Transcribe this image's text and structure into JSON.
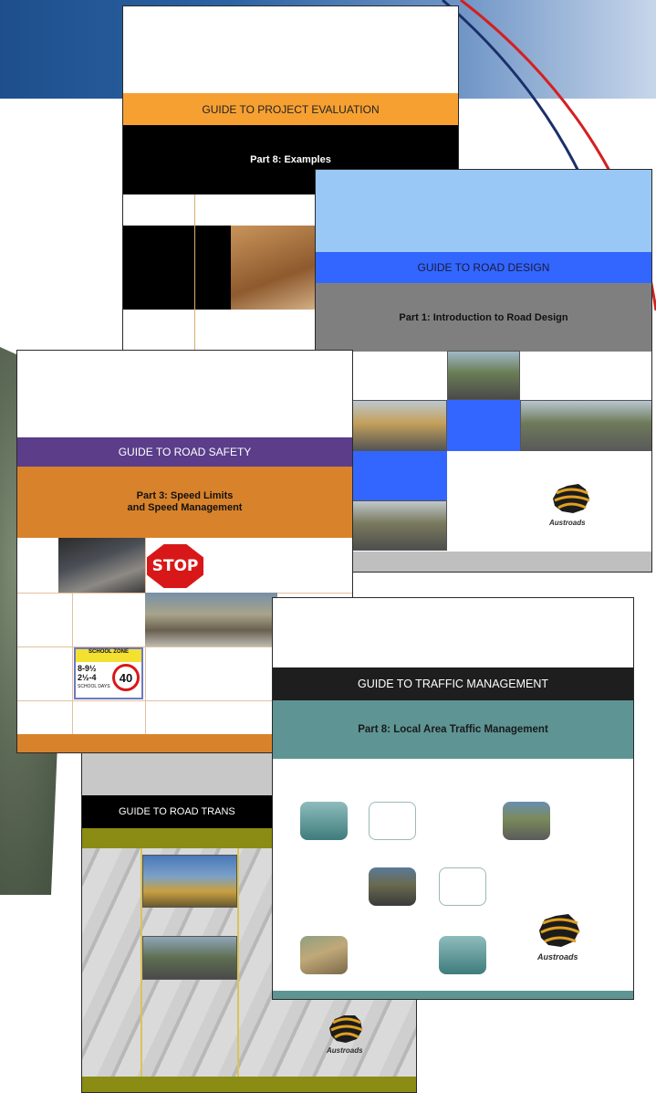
{
  "covers": {
    "project_evaluation": {
      "series": "GUIDE TO PROJECT EVALUATION",
      "part": "Part 8: Examples"
    },
    "road_design": {
      "series": "GUIDE TO ROAD DESIGN",
      "part": "Part 1: Introduction to Road Design",
      "logo": "Austroads"
    },
    "road_safety": {
      "series": "GUIDE TO ROAD SAFETY",
      "part": "Part 3: Speed Limits and Speed Management",
      "stop_sign": "STOP",
      "school_zone": "SCHOOL ZONE",
      "school_times": "8-9½ 2½-4",
      "school_days": "SCHOOL DAYS",
      "speed_limit": "40"
    },
    "road_transport": {
      "series": "GUIDE TO ROAD TRANS",
      "logo": "Austroads"
    },
    "traffic_management": {
      "series": "GUIDE TO TRAFFIC MANAGEMENT",
      "part": "Part 8: Local Area Traffic Management",
      "logo": "Austroads"
    }
  },
  "colors": {
    "banner": "#1e4f8c",
    "orange_band": "#f7a032",
    "blue_band": "#3366ff",
    "purple_band": "#5b3d8a",
    "rust_band": "#d8832b",
    "teal_band": "#5e9494",
    "olive_band": "#8a8c13"
  }
}
